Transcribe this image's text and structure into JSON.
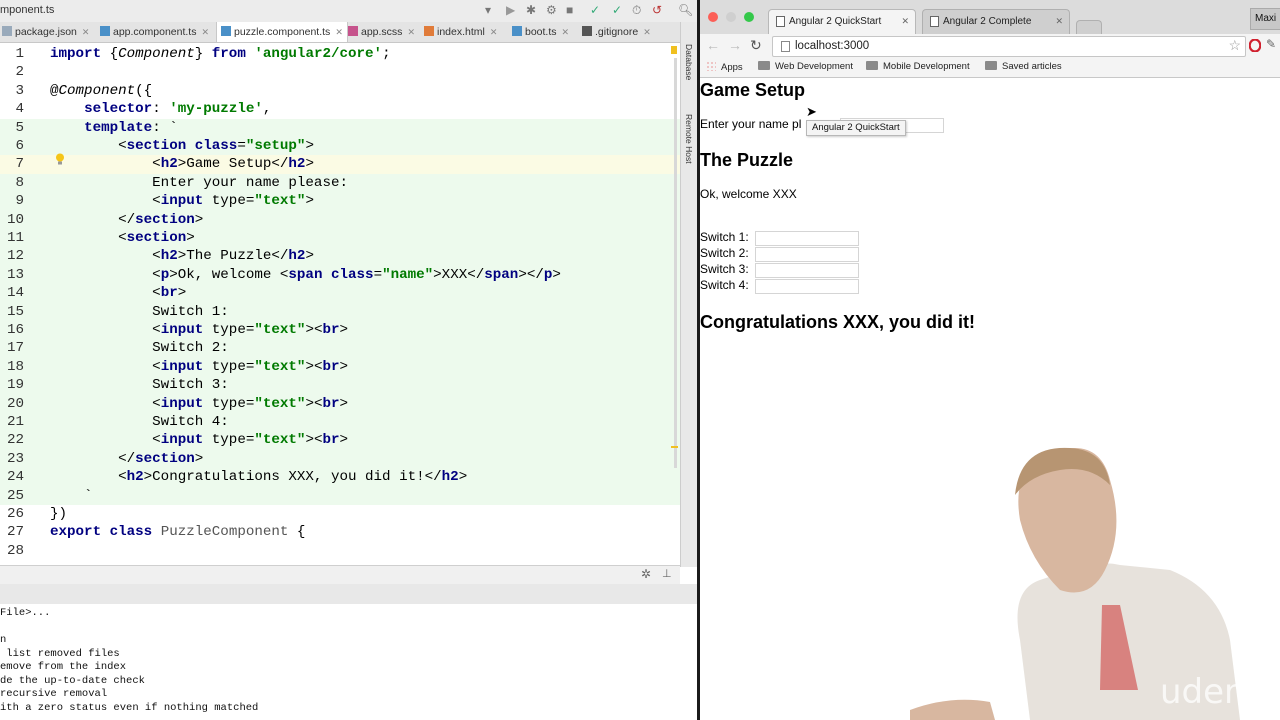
{
  "ide": {
    "breadcrumb": "mponent.ts",
    "tabs": [
      {
        "label": "package.json",
        "active": false
      },
      {
        "label": "app.component.ts",
        "active": false
      },
      {
        "label": "puzzle.component.ts",
        "active": true
      },
      {
        "label": "app.scss",
        "active": false
      },
      {
        "label": "index.html",
        "active": false
      },
      {
        "label": "boot.ts",
        "active": false
      },
      {
        "label": ".gitignore",
        "active": false
      }
    ],
    "side_labels": [
      "Database",
      "Remote Host"
    ],
    "code_lines": [
      {
        "n": "1",
        "text": "import {Component} from 'angular2/core';"
      },
      {
        "n": "2",
        "text": ""
      },
      {
        "n": "3",
        "text": "@Component({"
      },
      {
        "n": "4",
        "text": "    selector: 'my-puzzle',"
      },
      {
        "n": "5",
        "text": "    template: `"
      },
      {
        "n": "6",
        "text": "        <section class=\"setup\">"
      },
      {
        "n": "7",
        "text": "            <h2>Game Setup</h2>"
      },
      {
        "n": "8",
        "text": "            Enter your name please:"
      },
      {
        "n": "9",
        "text": "            <input type=\"text\">"
      },
      {
        "n": "10",
        "text": "        </section>"
      },
      {
        "n": "11",
        "text": "        <section>"
      },
      {
        "n": "12",
        "text": "            <h2>The Puzzle</h2>"
      },
      {
        "n": "13",
        "text": "            <p>Ok, welcome <span class=\"name\">XXX</span></p>"
      },
      {
        "n": "14",
        "text": "            <br>"
      },
      {
        "n": "15",
        "text": "            Switch 1:"
      },
      {
        "n": "16",
        "text": "            <input type=\"text\"><br>"
      },
      {
        "n": "17",
        "text": "            Switch 2:"
      },
      {
        "n": "18",
        "text": "            <input type=\"text\"><br>"
      },
      {
        "n": "19",
        "text": "            Switch 3:"
      },
      {
        "n": "20",
        "text": "            <input type=\"text\"><br>"
      },
      {
        "n": "21",
        "text": "            Switch 4:"
      },
      {
        "n": "22",
        "text": "            <input type=\"text\"><br>"
      },
      {
        "n": "23",
        "text": "        </section>"
      },
      {
        "n": "24",
        "text": "        <h2>Congratulations XXX, you did it!</h2>"
      },
      {
        "n": "25",
        "text": "    `"
      },
      {
        "n": "26",
        "text": "})"
      },
      {
        "n": "27",
        "text": "export class PuzzleComponent {"
      },
      {
        "n": "28",
        "text": ""
      }
    ],
    "terminal_lines": [
      "File>...",
      "",
      "n",
      " list removed files",
      "emove from the index",
      "de the up-to-date check",
      "recursive removal",
      "ith a zero status even if nothing matched"
    ]
  },
  "browser": {
    "tabs": [
      {
        "label": "Angular 2 QuickStart",
        "active": true
      },
      {
        "label": "Angular 2 Complete",
        "active": false
      }
    ],
    "profile": "Maxi",
    "url": "localhost:3000",
    "bookmarks": [
      "Apps",
      "Web Development",
      "Mobile Development",
      "Saved articles"
    ],
    "tooltip": "Angular 2 QuickStart",
    "page": {
      "h_setup": "Game Setup",
      "name_prompt": "Enter your name pl",
      "h_puzzle": "The Puzzle",
      "welcome": "Ok, welcome XXX",
      "switches": [
        "Switch 1:",
        "Switch 2:",
        "Switch 3:",
        "Switch 4:"
      ],
      "congrats": "Congratulations XXX, you did it!"
    }
  },
  "colors": {
    "keyword": "#000080",
    "string": "#007a00",
    "edit_bg": "#edfaed",
    "accent_red": "#d33"
  },
  "watermark": "uden"
}
